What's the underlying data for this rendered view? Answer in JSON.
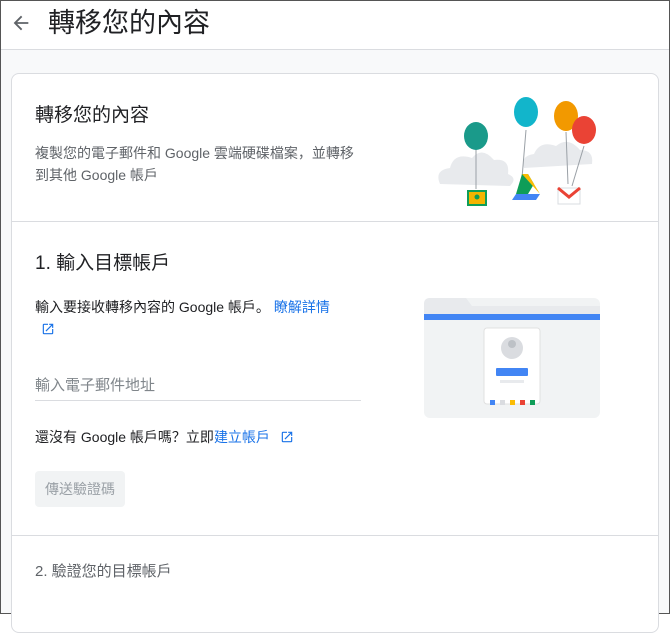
{
  "header": {
    "title": "轉移您的內容"
  },
  "intro": {
    "title": "轉移您的內容",
    "description": "複製您的電子郵件和 Google 雲端硬碟檔案，並轉移到其他 Google 帳戶"
  },
  "step1": {
    "title": "1. 輸入目標帳戶",
    "description": "輸入要接收轉移內容的 Google 帳戶。",
    "learn_more_label": "瞭解詳情",
    "email_placeholder": "輸入電子郵件地址",
    "no_account_prefix": "還沒有 Google 帳戶嗎？立即",
    "create_account_label": "建立帳戶",
    "send_code_label": "傳送驗證碼"
  },
  "step2": {
    "title": "2. 驗證您的目標帳戶"
  },
  "colors": {
    "link": "#1a73e8",
    "balloon_teal": "#1a9a8a",
    "balloon_cyan": "#12b5cb",
    "balloon_orange": "#f29900",
    "balloon_red": "#ea4335"
  }
}
